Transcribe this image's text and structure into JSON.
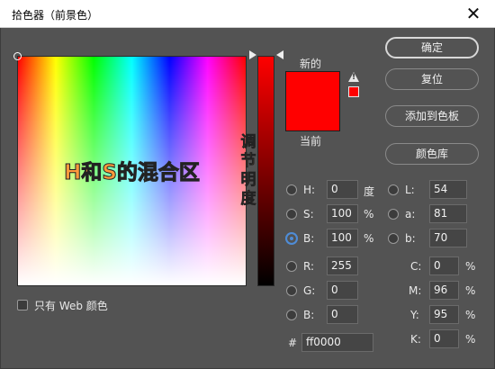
{
  "window": {
    "title": "拾色器（前景色）",
    "close_glyph": "✕"
  },
  "field": {
    "label": "H和S的混合区"
  },
  "slider": {
    "label": "调\n节\n明\n度"
  },
  "preview": {
    "new_label": "新的",
    "current_label": "当前",
    "new_color": "#ff0000",
    "current_color": "#ff0000",
    "warning_icon": "gamut-warning-icon",
    "warning_mark": "!"
  },
  "buttons": {
    "ok": "确定",
    "reset": "复位",
    "add_to_swatches": "添加到色板",
    "color_libraries": "颜色库"
  },
  "hsb": {
    "h": {
      "label": "H:",
      "value": "0",
      "unit": "度"
    },
    "s": {
      "label": "S:",
      "value": "100",
      "unit": "%"
    },
    "b": {
      "label": "B:",
      "value": "100",
      "unit": "%"
    },
    "selected": "B"
  },
  "lab": {
    "l": {
      "label": "L:",
      "value": "54"
    },
    "a": {
      "label": "a:",
      "value": "81"
    },
    "b": {
      "label": "b:",
      "value": "70"
    }
  },
  "rgb": {
    "r": {
      "label": "R:",
      "value": "255"
    },
    "g": {
      "label": "G:",
      "value": "0"
    },
    "b": {
      "label": "B:",
      "value": "0"
    }
  },
  "cmyk": {
    "c": {
      "label": "C:",
      "value": "0",
      "unit": "%"
    },
    "m": {
      "label": "M:",
      "value": "96",
      "unit": "%"
    },
    "y": {
      "label": "Y:",
      "value": "95",
      "unit": "%"
    },
    "k": {
      "label": "K:",
      "value": "0",
      "unit": "%"
    }
  },
  "hex": {
    "label": "#",
    "value": "ff0000"
  },
  "web_only": {
    "label": "只有 Web 颜色",
    "checked": false
  }
}
